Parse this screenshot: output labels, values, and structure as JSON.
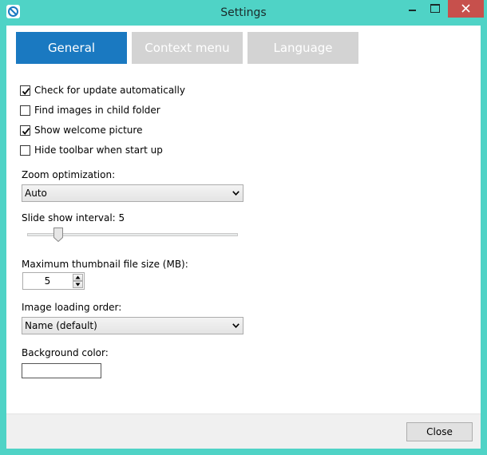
{
  "window": {
    "title": "Settings"
  },
  "tabs": [
    {
      "label": "General",
      "active": true
    },
    {
      "label": "Context menu",
      "active": false
    },
    {
      "label": "Language",
      "active": false
    }
  ],
  "general": {
    "checkboxes": [
      {
        "label": "Check for update automatically",
        "checked": true
      },
      {
        "label": "Find images in child folder",
        "checked": false
      },
      {
        "label": "Show welcome picture",
        "checked": true
      },
      {
        "label": "Hide toolbar when start up",
        "checked": false
      }
    ],
    "zoom": {
      "label": "Zoom optimization:",
      "value": "Auto"
    },
    "slideshow": {
      "label": "Slide show interval: 5",
      "value": 5
    },
    "thumbnail": {
      "label": "Maximum thumbnail file size (MB):",
      "value": "5"
    },
    "loading_order": {
      "label": "Image loading order:",
      "value": "Name (default)"
    },
    "background": {
      "label": "Background color:",
      "color": "#ffffff"
    }
  },
  "footer": {
    "close_label": "Close"
  },
  "colors": {
    "frame": "#4fd3c6",
    "tab_active": "#1a79c1",
    "tab_inactive": "#d3d3d3",
    "close_window": "#c7504c"
  },
  "icons": {
    "app": "app-logo-icon",
    "minimize": "minimize-icon",
    "maximize": "maximize-icon",
    "close": "close-icon",
    "check": "check-icon",
    "dropdown": "chevron-down-icon",
    "spin_up": "arrow-up-icon",
    "spin_down": "arrow-down-icon"
  }
}
